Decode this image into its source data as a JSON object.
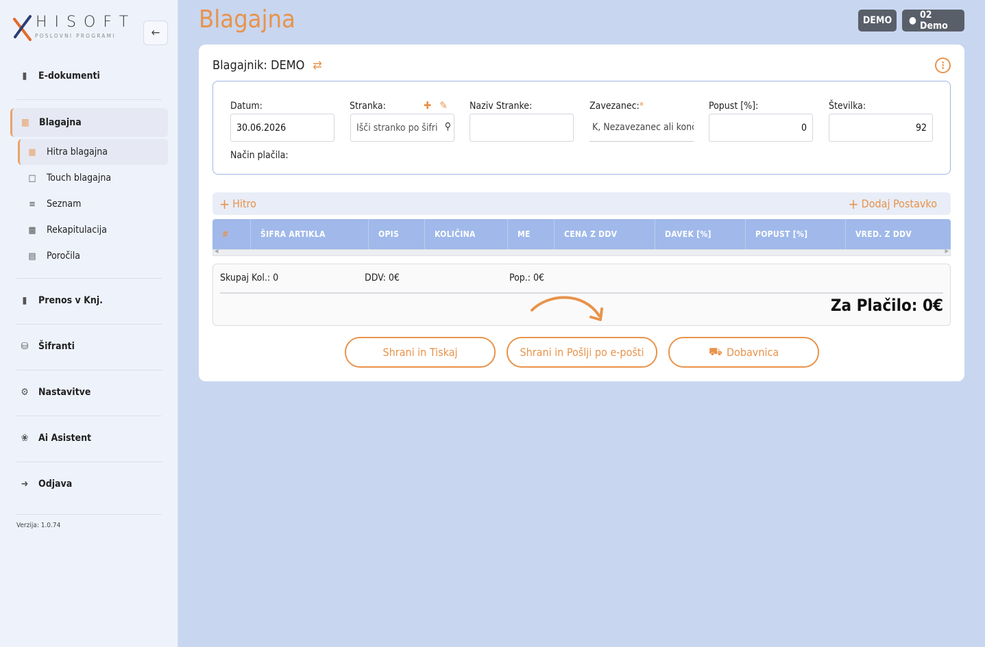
{
  "brand": {
    "name": "HISOFT",
    "tagline": "POSLOVNI PROGRAMI"
  },
  "sidebar": {
    "items": [
      {
        "label": "E-dokumenti",
        "icon": "file-icon"
      },
      {
        "label": "Blagajna",
        "icon": "cash-register-icon"
      },
      {
        "label": "Prenos v Knj.",
        "icon": "book-icon"
      },
      {
        "label": "Šifranti",
        "icon": "database-icon"
      },
      {
        "label": "Nastavitve",
        "icon": "gear-icon"
      },
      {
        "label": "Ai Asistent",
        "icon": "brain-icon"
      },
      {
        "label": "Odjava",
        "icon": "logout-icon"
      }
    ],
    "subitems": [
      {
        "label": "Hitra blagajna",
        "icon": "cash-register-icon"
      },
      {
        "label": "Touch blagajna",
        "icon": "tablet-icon"
      },
      {
        "label": "Seznam",
        "icon": "list-icon"
      },
      {
        "label": "Rekapitulacija",
        "icon": "money-icon"
      },
      {
        "label": "Poročila",
        "icon": "report-icon"
      }
    ],
    "version": "Verzija: 1.0.74"
  },
  "header": {
    "title": "Blagajna",
    "badge_company": "DEMO",
    "badge_user": "02 Demo"
  },
  "cashier": {
    "label": "Blagajnik: DEMO"
  },
  "form": {
    "datum_label": "Datum:",
    "datum_value": "30.06.2026",
    "stranka_label": "Stranka:",
    "stranka_placeholder": "Išči stranko po šifri",
    "naziv_label": "Naziv Stranke:",
    "naziv_value": "",
    "zavezanec_label": "Zavezanec:",
    "zavezanec_required": "*",
    "zavezanec_value": "K, Nezavezanec ali konč",
    "popust_label": "Popust [%]:",
    "popust_value": "0",
    "stevilka_label": "Številka:",
    "stevilka_value": "92",
    "nacin_label": "Način plačila:"
  },
  "quick": {
    "hitro": "Hitro",
    "dodaj": "Dodaj Postavko"
  },
  "table": {
    "columns": [
      "#",
      "ŠIFRA ARTIKLA",
      "OPIS",
      "KOLIČINA",
      "ME",
      "CENA Z DDV",
      "DAVEK [%]",
      "POPUST [%]",
      "VRED. Z DDV"
    ]
  },
  "summary": {
    "kol": "Skupaj Kol.: 0",
    "ddv": "DDV: 0€",
    "pop": "Pop.: 0€",
    "total": "Za Plačilo: 0€"
  },
  "actions": {
    "print": "Shrani in Tiskaj",
    "email": "Shrani in Pošlji po e-pošti",
    "delivery": "Dobavnica"
  },
  "colors": {
    "accent": "#e8934b",
    "table_header": "#a0b9ea",
    "badge": "#595f69",
    "background": "#c8d6f0"
  }
}
